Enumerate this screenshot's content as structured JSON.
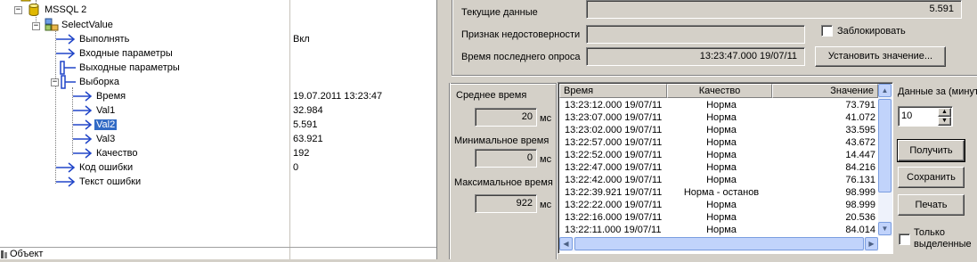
{
  "tree": {
    "server": "MSSQL 2",
    "node": "SelectValue",
    "items": [
      {
        "label": "Выполнять",
        "value": "Вкл"
      },
      {
        "label": "Входные параметры",
        "value": ""
      },
      {
        "label": "Выходные параметры",
        "value": ""
      },
      {
        "label": "Выборка",
        "value": ""
      },
      {
        "label": "Время",
        "value": "19.07.2011 13:23:47"
      },
      {
        "label": "Val1",
        "value": "32.984"
      },
      {
        "label": "Val2",
        "value": "5.591"
      },
      {
        "label": "Val3",
        "value": "63.921"
      },
      {
        "label": "Качество",
        "value": "192"
      },
      {
        "label": "Код ошибки",
        "value": "0"
      },
      {
        "label": "Текст ошибки",
        "value": ""
      }
    ],
    "bottom_label": "Объект",
    "icons": [
      "expand-toggle-icon",
      "database-icon",
      "hierarchy-icon",
      "arrow-node-icon"
    ]
  },
  "current": {
    "current_data_label": "Текущие данные",
    "current_data_value": "5.591",
    "unreliable_label": "Признак недостоверности",
    "unreliable_value": "",
    "lock_label": "Заблокировать",
    "last_poll_label": "Время последнего опроса",
    "last_poll_value": "13:23:47.000 19/07/11",
    "set_value_button": "Установить значение..."
  },
  "stats": {
    "avg_label": "Среднее время",
    "avg_value": "20",
    "min_label": "Минимальное время",
    "min_value": "0",
    "max_label": "Максимальное время",
    "max_value": "922",
    "unit": "мс"
  },
  "grid": {
    "columns": [
      "Время",
      "Качество",
      "Значение"
    ],
    "rows": [
      [
        "13:23:12.000 19/07/11",
        "Норма",
        "73.791"
      ],
      [
        "13:23:07.000 19/07/11",
        "Норма",
        "41.072"
      ],
      [
        "13:23:02.000 19/07/11",
        "Норма",
        "33.595"
      ],
      [
        "13:22:57.000 19/07/11",
        "Норма",
        "43.672"
      ],
      [
        "13:22:52.000 19/07/11",
        "Норма",
        "14.447"
      ],
      [
        "13:22:47.000 19/07/11",
        "Норма",
        "84.216"
      ],
      [
        "13:22:42.000 19/07/11",
        "Норма",
        "76.131"
      ],
      [
        "13:22:39.921 19/07/11",
        "Норма - останов",
        "98.999"
      ],
      [
        "13:22:22.000 19/07/11",
        "Норма",
        "98.999"
      ],
      [
        "13:22:16.000 19/07/11",
        "Норма",
        "20.536"
      ],
      [
        "13:22:11.000 19/07/11",
        "Норма",
        "84.014"
      ]
    ]
  },
  "controls": {
    "period_label": "Данные за (минут",
    "period_value": "10",
    "get_button": "Получить",
    "save_button": "Сохранить",
    "print_button": "Печать",
    "only_selected_line1": "Только",
    "only_selected_line2": "выделенные"
  },
  "colors": {
    "selection": "#316ac5",
    "panel": "#d4d0c8",
    "scrollbar": "#c1d3fb"
  }
}
